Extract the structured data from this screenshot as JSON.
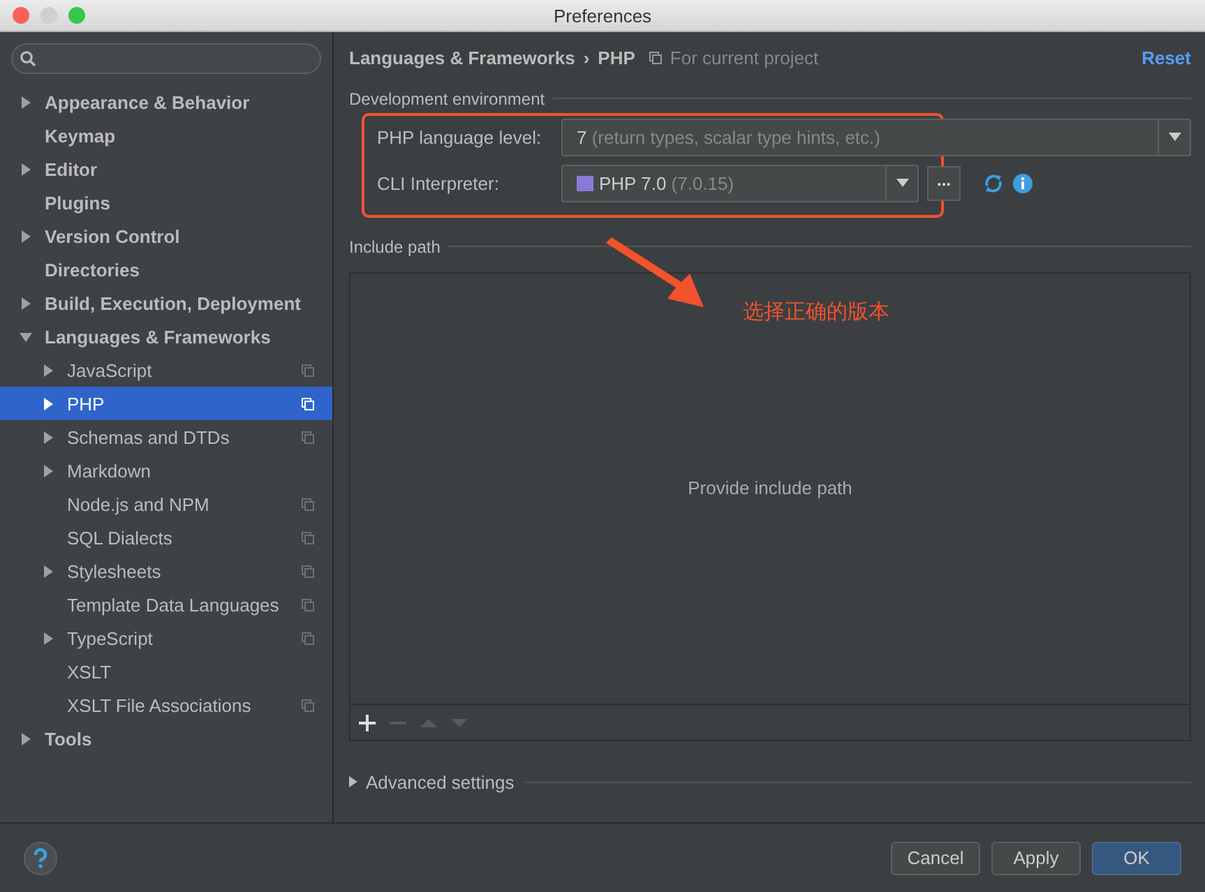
{
  "window": {
    "title": "Preferences"
  },
  "sidebar": {
    "items": [
      {
        "label": "Appearance & Behavior",
        "expandable": true,
        "expanded": false,
        "selected": false,
        "project_scoped": false
      },
      {
        "label": "Keymap",
        "expandable": false,
        "selected": false,
        "project_scoped": false
      },
      {
        "label": "Editor",
        "expandable": true,
        "expanded": false,
        "selected": false,
        "project_scoped": false
      },
      {
        "label": "Plugins",
        "expandable": false,
        "selected": false,
        "project_scoped": false
      },
      {
        "label": "Version Control",
        "expandable": true,
        "expanded": false,
        "selected": false,
        "project_scoped": false
      },
      {
        "label": "Directories",
        "expandable": false,
        "selected": false,
        "project_scoped": false
      },
      {
        "label": "Build, Execution, Deployment",
        "expandable": true,
        "expanded": false,
        "selected": false,
        "project_scoped": false
      },
      {
        "label": "Languages & Frameworks",
        "expandable": true,
        "expanded": true,
        "selected": false,
        "project_scoped": false,
        "children": [
          {
            "label": "JavaScript",
            "expandable": true,
            "expanded": false,
            "selected": false,
            "project_scoped": true
          },
          {
            "label": "PHP",
            "expandable": true,
            "expanded": false,
            "selected": true,
            "project_scoped": true
          },
          {
            "label": "Schemas and DTDs",
            "expandable": true,
            "expanded": false,
            "selected": false,
            "project_scoped": true
          },
          {
            "label": "Markdown",
            "expandable": true,
            "expanded": false,
            "selected": false,
            "project_scoped": false
          },
          {
            "label": "Node.js and NPM",
            "expandable": false,
            "selected": false,
            "project_scoped": true
          },
          {
            "label": "SQL Dialects",
            "expandable": false,
            "selected": false,
            "project_scoped": true
          },
          {
            "label": "Stylesheets",
            "expandable": true,
            "expanded": false,
            "selected": false,
            "project_scoped": true
          },
          {
            "label": "Template Data Languages",
            "expandable": false,
            "selected": false,
            "project_scoped": true
          },
          {
            "label": "TypeScript",
            "expandable": true,
            "expanded": false,
            "selected": false,
            "project_scoped": true
          },
          {
            "label": "XSLT",
            "expandable": false,
            "selected": false,
            "project_scoped": false
          },
          {
            "label": "XSLT File Associations",
            "expandable": false,
            "selected": false,
            "project_scoped": true
          }
        ]
      },
      {
        "label": "Tools",
        "expandable": true,
        "expanded": false,
        "selected": false,
        "project_scoped": false
      }
    ]
  },
  "header": {
    "breadcrumb": [
      "Languages & Frameworks",
      "›",
      "PHP"
    ],
    "scope": "For current project",
    "reset": "Reset"
  },
  "development_environment": {
    "title": "Development environment",
    "language_level": {
      "label": "PHP language level:",
      "value": "7",
      "hint": "(return types, scalar type hints, etc.)"
    },
    "cli_interpreter": {
      "label": "CLI Interpreter:",
      "value": "PHP 7.0",
      "hint": "(7.0.15)",
      "browse": "..."
    }
  },
  "include_path": {
    "title": "Include path",
    "empty_text": "Provide include path",
    "toolbar": [
      {
        "kind": "add",
        "disabled": false
      },
      {
        "kind": "remove",
        "disabled": true
      },
      {
        "kind": "up",
        "disabled": true
      },
      {
        "kind": "down",
        "disabled": true
      }
    ]
  },
  "advanced_settings": {
    "label": "Advanced settings",
    "expanded": false
  },
  "annotation": {
    "text": "选择正确的版本"
  },
  "buttons": [
    {
      "label": "Cancel",
      "kind": "normal"
    },
    {
      "label": "Apply",
      "kind": "normal"
    },
    {
      "label": "OK",
      "kind": "default"
    }
  ]
}
